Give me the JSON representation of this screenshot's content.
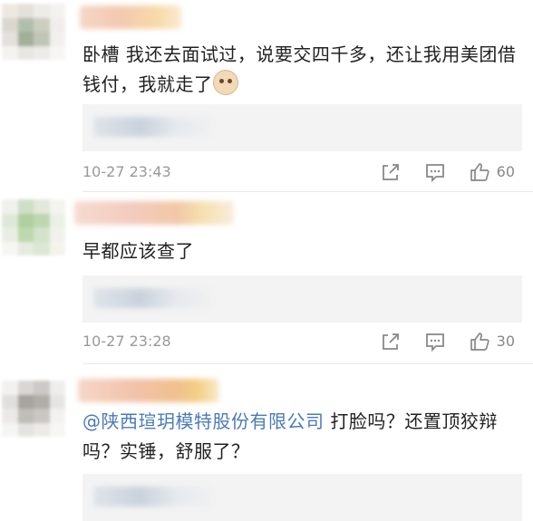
{
  "comments": [
    {
      "text": "卧槽 我还去面试过，说要交四千多，还让我用美团借钱付，我就走了",
      "time": "10-27 23:43",
      "likes": "60"
    },
    {
      "text": "早都应该查了",
      "time": "10-27 23:28",
      "likes": "30"
    },
    {
      "mention": "@陕西瑄玥模特股份有限公司",
      "text": " 打脸吗？还置顶狡辩吗？实锤，舒服了？"
    }
  ],
  "icons": {
    "share": "share-icon",
    "comment": "comment-icon",
    "like": "like-icon"
  },
  "colors": {
    "mention": "#4a7bb7",
    "meta": "#999999",
    "reply_bg": "#f3f3f3"
  }
}
